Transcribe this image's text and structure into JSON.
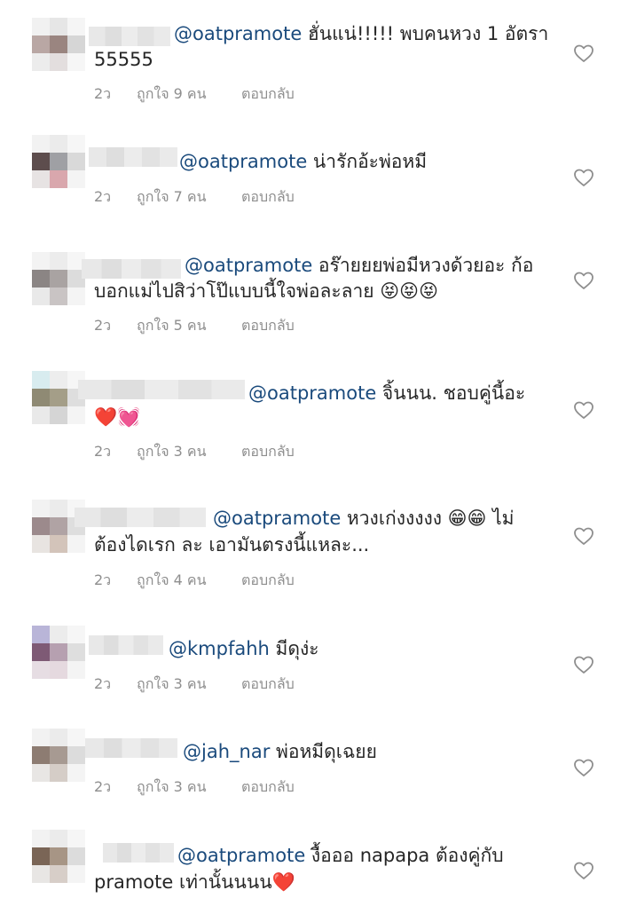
{
  "comments": [
    {
      "mention": "@oatpramote",
      "text": " ฮั่นแน่!!!!! พบคนหวง 1 อัตรา",
      "text2": "55555",
      "time": "2ว",
      "likes": "ถูกใจ 9 คน",
      "reply": "ตอบกลับ"
    },
    {
      "mention": "@oatpramote",
      "text": " น่ารักอ้ะพ่อหมี",
      "text2": "",
      "time": "2ว",
      "likes": "ถูกใจ 7 คน",
      "reply": "ตอบกลับ"
    },
    {
      "mention": "@oatpramote",
      "text": " อร๊ายยยพ่อมีหวงด้วยอะ ก้อ",
      "text2": "บอกแม่ไปสิว่าโป๊แบบนี้ใจพ่อละลาย 😝😝😝",
      "time": "2ว",
      "likes": "ถูกใจ 5 คน",
      "reply": "ตอบกลับ"
    },
    {
      "mention": "@oatpramote",
      "text": " จิ้นนน.  ชอบคู่นี้อะ",
      "text2": "❤️💓",
      "time": "2ว",
      "likes": "ถูกใจ 3 คน",
      "reply": "ตอบกลับ"
    },
    {
      "mention": "@oatpramote",
      "text": " หวงเก่งงงงง 😁😁 ไม่",
      "text2": "ต้องไดเรก ละ เอามันตรงนี้แหละ...",
      "time": "2ว",
      "likes": "ถูกใจ 4 คน",
      "reply": "ตอบกลับ"
    },
    {
      "mention": "@kmpfahh",
      "text": "  มีดุง่ะ",
      "text2": "",
      "time": "2ว",
      "likes": "ถูกใจ 3 คน",
      "reply": "ตอบกลับ"
    },
    {
      "mention": "@jah_nar",
      "text": " พ่อหมีดุเฉยย",
      "text2": "",
      "time": "2ว",
      "likes": "ถูกใจ 3 คน",
      "reply": "ตอบกลับ"
    },
    {
      "mention": "@oatpramote",
      "text": " งื้อออ napapa ต้องคู่กับ",
      "text2": "pramote เท่านั้นนนน❤️",
      "time": "",
      "likes": "",
      "reply": ""
    }
  ]
}
